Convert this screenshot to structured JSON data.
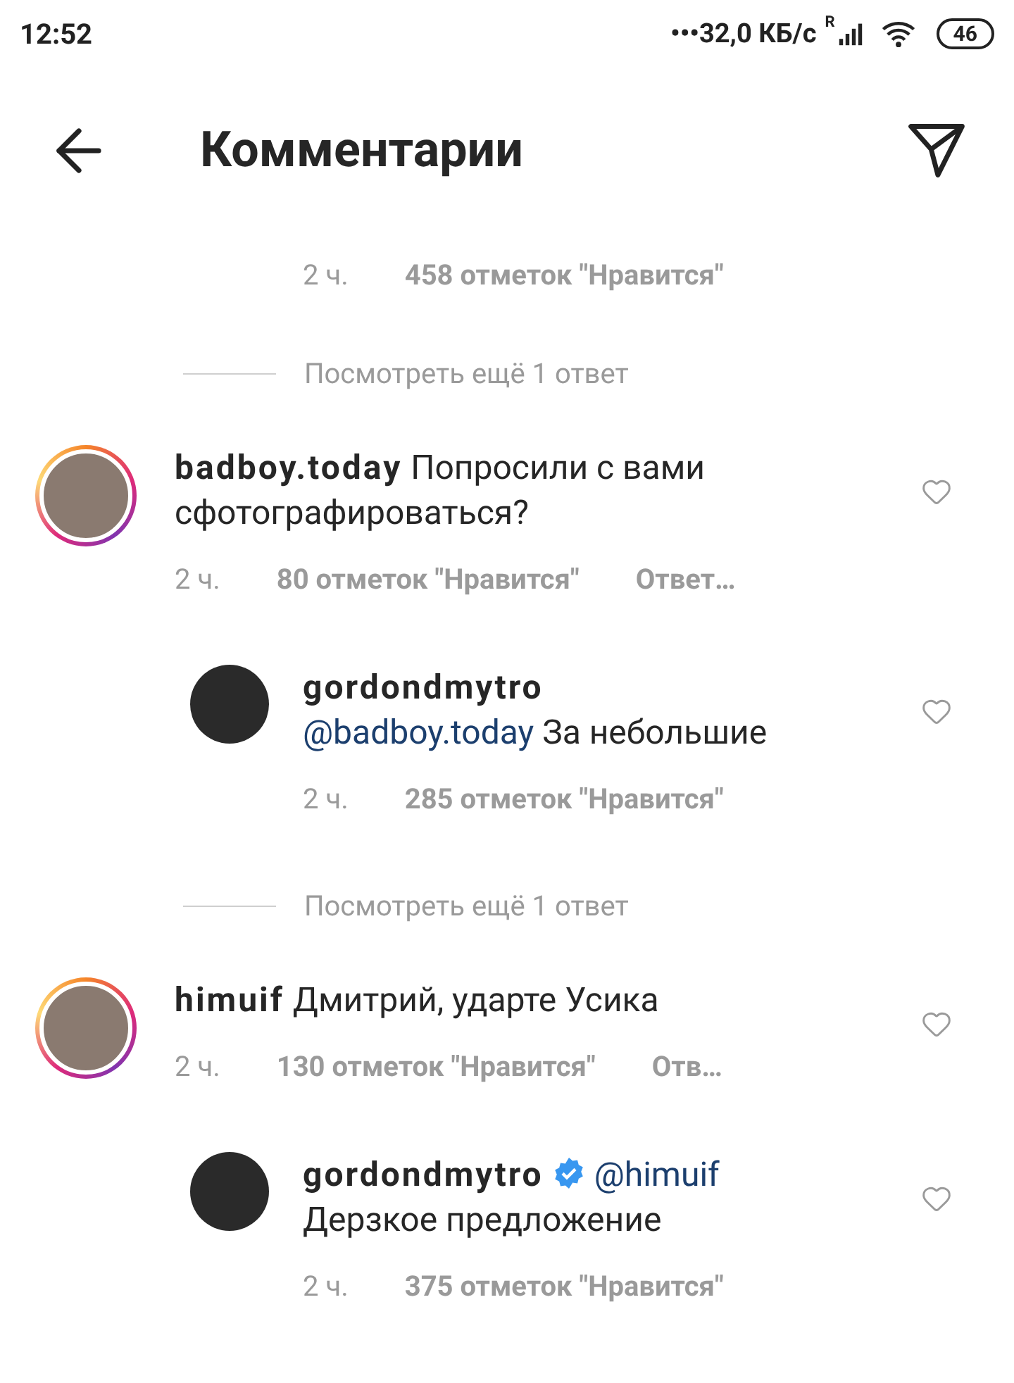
{
  "status_bar": {
    "time": "12:52",
    "network_speed": "•••32,0 КБ/с",
    "roaming": "R",
    "battery": "46"
  },
  "header": {
    "title": "Комментарии"
  },
  "items": [
    {
      "kind": "reply",
      "time": "2 ч.",
      "likes": "458 отметок \"Нравится\""
    },
    {
      "kind": "more",
      "label": "Посмотреть ещё 1 ответ"
    },
    {
      "kind": "comment",
      "username": "badboy.today",
      "verified": false,
      "text": "Попросили с вами сфотографироваться?",
      "time": "2 ч.",
      "likes": "80 отметок \"Нравится\"",
      "reply": "Ответ…",
      "story_ring": true,
      "liked": false
    },
    {
      "kind": "reply",
      "username": "gordondmytro",
      "verified": false,
      "mention": "@badboy.today",
      "text": "За небольшие",
      "time": "2 ч.",
      "likes": "285 отметок \"Нравится\"",
      "story_ring": false,
      "liked": false
    },
    {
      "kind": "more",
      "label": "Посмотреть ещё 1 ответ"
    },
    {
      "kind": "comment",
      "username": "himuif",
      "verified": false,
      "text": "Дмитрий, ударте Усика",
      "time": "2 ч.",
      "likes": "130 отметок \"Нравится\"",
      "reply": "Отв…",
      "story_ring": true,
      "liked": false
    },
    {
      "kind": "reply",
      "username": "gordondmytro",
      "verified": true,
      "mention": "@himuif",
      "text": "Дерзкое предложение",
      "time": "2 ч.",
      "likes": "375 отметок \"Нравится\"",
      "story_ring": false,
      "liked": false
    }
  ]
}
